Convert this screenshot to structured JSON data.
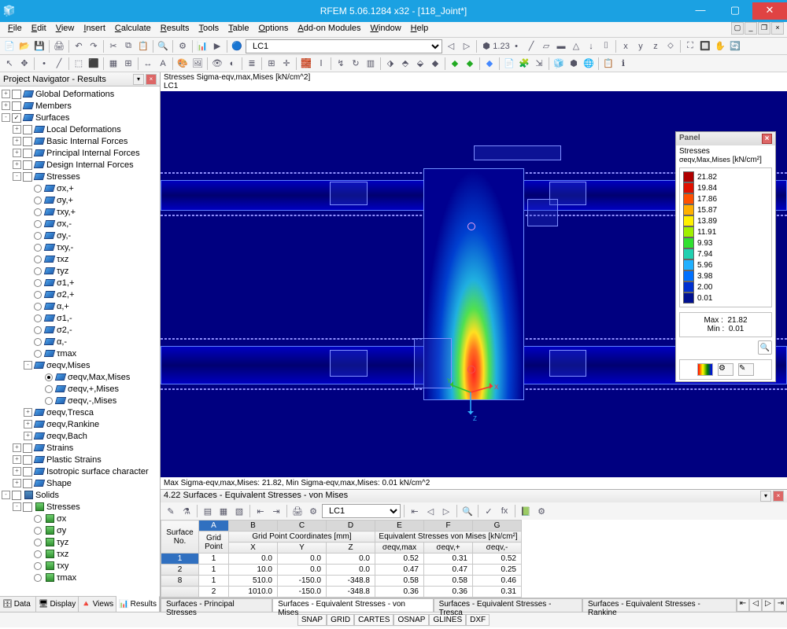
{
  "title": "RFEM 5.06.1284 x32 - [118_Joint*]",
  "menu": [
    "File",
    "Edit",
    "View",
    "Insert",
    "Calculate",
    "Results",
    "Tools",
    "Table",
    "Options",
    "Add-on Modules",
    "Window",
    "Help"
  ],
  "load_case": "LC1",
  "navigator": {
    "title": "Project Navigator - Results",
    "tabs": [
      {
        "icon": "🗄",
        "label": "Data"
      },
      {
        "icon": "🖥",
        "label": "Display"
      },
      {
        "icon": "🔺",
        "label": "Views"
      },
      {
        "icon": "📊",
        "label": "Results",
        "active": true
      }
    ],
    "tree": [
      {
        "depth": 0,
        "exp": "+",
        "chk": "",
        "ico": "globe",
        "label": "Global Deformations"
      },
      {
        "depth": 0,
        "exp": "+",
        "chk": "",
        "ico": "memb",
        "label": "Members"
      },
      {
        "depth": 0,
        "exp": "-",
        "chk": "✓",
        "ico": "surf",
        "label": "Surfaces"
      },
      {
        "depth": 1,
        "exp": "+",
        "chk": "",
        "ico": "surf",
        "label": "Local Deformations"
      },
      {
        "depth": 1,
        "exp": "+",
        "chk": "",
        "ico": "surf",
        "label": "Basic Internal Forces"
      },
      {
        "depth": 1,
        "exp": "+",
        "chk": "",
        "ico": "surf",
        "label": "Principal Internal Forces"
      },
      {
        "depth": 1,
        "exp": "+",
        "chk": "",
        "ico": "surf",
        "label": "Design Internal Forces"
      },
      {
        "depth": 1,
        "exp": "-",
        "chk": "",
        "ico": "surf",
        "label": "Stresses"
      },
      {
        "depth": 2,
        "radio": false,
        "ico": "surf",
        "label": "σx,+"
      },
      {
        "depth": 2,
        "radio": false,
        "ico": "surf",
        "label": "σy,+"
      },
      {
        "depth": 2,
        "radio": false,
        "ico": "surf",
        "label": "τxy,+"
      },
      {
        "depth": 2,
        "radio": false,
        "ico": "surf",
        "label": "σx,-"
      },
      {
        "depth": 2,
        "radio": false,
        "ico": "surf",
        "label": "σy,-"
      },
      {
        "depth": 2,
        "radio": false,
        "ico": "surf",
        "label": "τxy,-"
      },
      {
        "depth": 2,
        "radio": false,
        "ico": "surf",
        "label": "τxz"
      },
      {
        "depth": 2,
        "radio": false,
        "ico": "surf",
        "label": "τyz"
      },
      {
        "depth": 2,
        "radio": false,
        "ico": "surf",
        "label": "σ1,+"
      },
      {
        "depth": 2,
        "radio": false,
        "ico": "surf",
        "label": "σ2,+"
      },
      {
        "depth": 2,
        "radio": false,
        "ico": "surf",
        "label": "α,+"
      },
      {
        "depth": 2,
        "radio": false,
        "ico": "surf",
        "label": "σ1,-"
      },
      {
        "depth": 2,
        "radio": false,
        "ico": "surf",
        "label": "σ2,-"
      },
      {
        "depth": 2,
        "radio": false,
        "ico": "surf",
        "label": "α,-"
      },
      {
        "depth": 2,
        "radio": false,
        "ico": "surf",
        "label": "τmax"
      },
      {
        "depth": 2,
        "exp": "-",
        "ico": "surf",
        "label": "σeqv,Mises"
      },
      {
        "depth": 3,
        "radio": true,
        "ico": "surf",
        "label": "σeqv,Max,Mises"
      },
      {
        "depth": 3,
        "radio": false,
        "ico": "surf",
        "label": "σeqv,+,Mises"
      },
      {
        "depth": 3,
        "radio": false,
        "ico": "surf",
        "label": "σeqv,-,Mises"
      },
      {
        "depth": 2,
        "exp": "+",
        "ico": "surf",
        "label": "σeqv,Tresca"
      },
      {
        "depth": 2,
        "exp": "+",
        "ico": "surf",
        "label": "σeqv,Rankine"
      },
      {
        "depth": 2,
        "exp": "+",
        "ico": "surf",
        "label": "σeqv,Bach"
      },
      {
        "depth": 1,
        "exp": "+",
        "chk": "",
        "ico": "surf",
        "label": "Strains"
      },
      {
        "depth": 1,
        "exp": "+",
        "chk": "",
        "ico": "surf",
        "label": "Plastic Strains"
      },
      {
        "depth": 1,
        "exp": "+",
        "chk": "",
        "ico": "surf",
        "label": "Isotropic surface character"
      },
      {
        "depth": 1,
        "exp": "+",
        "chk": "",
        "ico": "surf",
        "label": "Shape"
      },
      {
        "depth": 0,
        "exp": "-",
        "chk": "",
        "ico": "solid",
        "label": "Solids"
      },
      {
        "depth": 1,
        "exp": "-",
        "chk": "",
        "ico": "green",
        "label": "Stresses"
      },
      {
        "depth": 2,
        "radio": false,
        "ico": "green",
        "label": "σx"
      },
      {
        "depth": 2,
        "radio": false,
        "ico": "green",
        "label": "σy"
      },
      {
        "depth": 2,
        "radio": false,
        "ico": "green",
        "label": "τyz"
      },
      {
        "depth": 2,
        "radio": false,
        "ico": "green",
        "label": "τxz"
      },
      {
        "depth": 2,
        "radio": false,
        "ico": "green",
        "label": "τxy"
      },
      {
        "depth": 2,
        "radio": false,
        "ico": "green",
        "label": "τmax"
      }
    ]
  },
  "viewport": {
    "header1": "Stresses Sigma-eqv,max,Mises [kN/cm^2]",
    "header2": "LC1",
    "status": "Max Sigma-eqv,max,Mises: 21.82, Min Sigma-eqv,max,Mises: 0.01 kN/cm^2"
  },
  "panel": {
    "title": "Panel",
    "subtitle": "Stresses",
    "quantity": "σeqv,Max,Mises",
    "unit": "[kN/cm²]",
    "legend": [
      {
        "color": "#b00000",
        "val": "21.82"
      },
      {
        "color": "#e01000",
        "val": "19.84"
      },
      {
        "color": "#ff5000",
        "val": "17.86"
      },
      {
        "color": "#ffb000",
        "val": "15.87"
      },
      {
        "color": "#fff000",
        "val": "13.89"
      },
      {
        "color": "#a0f000",
        "val": "11.91"
      },
      {
        "color": "#30e030",
        "val": "9.93"
      },
      {
        "color": "#20d0b0",
        "val": "7.94"
      },
      {
        "color": "#20b0ff",
        "val": "5.96"
      },
      {
        "color": "#0070ff",
        "val": "3.98"
      },
      {
        "color": "#0030d0",
        "val": "2.00"
      },
      {
        "color": "#001090",
        "val": "0.01"
      }
    ],
    "max_label": "Max  :",
    "max": "21.82",
    "min_label": "Min   :",
    "min": "0.01"
  },
  "results": {
    "title": "4.22 Surfaces - Equivalent Stresses - von Mises",
    "lc": "LC1",
    "col_letters": [
      "A",
      "B",
      "C",
      "D",
      "E",
      "F",
      "G"
    ],
    "headers1": {
      "surf": "Surface\nNo.",
      "grid": "Grid\nPoint",
      "coords": "Grid Point Coordinates [mm]",
      "eqv": "Equivalent Stresses von Mises [kN/cm²]"
    },
    "headers2": [
      "X",
      "Y",
      "Z",
      "σeqv,max",
      "σeqv,+",
      "σeqv,-"
    ],
    "rows": [
      {
        "surf": "1",
        "grid": "1",
        "x": "0.0",
        "y": "0.0",
        "z": "0.0",
        "max": "0.52",
        "plus": "0.31",
        "minus": "0.52",
        "sel": true
      },
      {
        "surf": "2",
        "grid": "1",
        "x": "10.0",
        "y": "0.0",
        "z": "0.0",
        "max": "0.47",
        "plus": "0.47",
        "minus": "0.25"
      },
      {
        "surf": "8",
        "grid": "1",
        "x": "510.0",
        "y": "-150.0",
        "z": "-348.8",
        "max": "0.58",
        "plus": "0.58",
        "minus": "0.46"
      },
      {
        "surf": "",
        "grid": "2",
        "x": "1010.0",
        "y": "-150.0",
        "z": "-348.8",
        "max": "0.36",
        "plus": "0.36",
        "minus": "0.31"
      }
    ],
    "tabs": [
      {
        "label": "Surfaces - Principal Stresses"
      },
      {
        "label": "Surfaces - Equivalent Stresses - von Mises",
        "active": true
      },
      {
        "label": "Surfaces - Equivalent Stresses - Tresca"
      },
      {
        "label": "Surfaces - Equivalent Stresses - Rankine"
      }
    ]
  },
  "statusbar": [
    "SNAP",
    "GRID",
    "CARTES",
    "OSNAP",
    "GLINES",
    "DXF"
  ]
}
